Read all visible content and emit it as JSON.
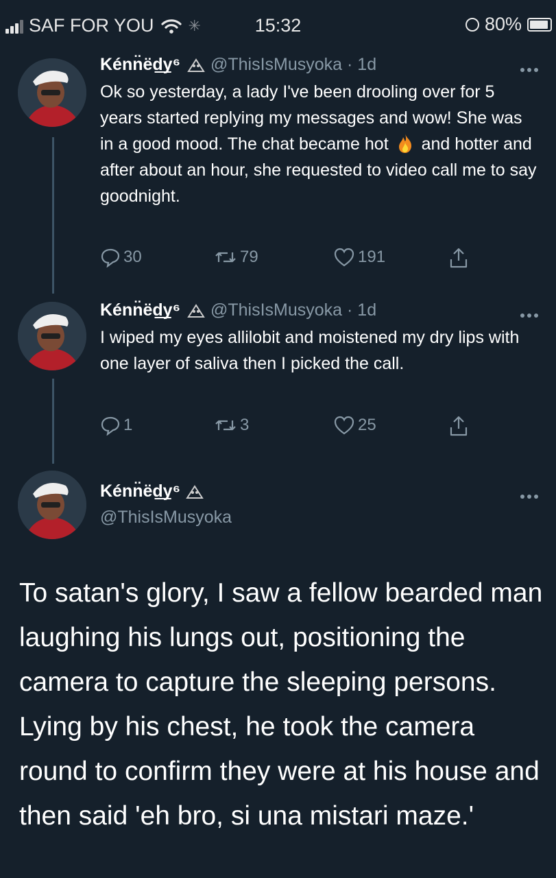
{
  "status_bar": {
    "carrier": "SAF FOR YOU",
    "time": "15:32",
    "battery": "80%",
    "battery_level": 0.8
  },
  "colors": {
    "background": "#15202b",
    "text_primary": "#ffffff",
    "text_secondary": "#8899a6",
    "thread_line": "#3d5466"
  },
  "tweets": [
    {
      "display_name": "Kénn̈ëd͟y⁶",
      "handle_time": "@ThisIsMusyoka · 1d",
      "text_before_emoji": "Ok so yesterday, a lady I've been drooling over for 5 years started replying my messages and wow! She was in a good mood. The chat became hot",
      "emoji": "fire-emoji",
      "text_after_emoji": "and hotter and after about an hour, she requested to video call me to say goodnight.",
      "replies": "30",
      "retweets": "79",
      "likes": "191"
    },
    {
      "display_name": "Kénn̈ëd͟y⁶",
      "handle_time": "@ThisIsMusyoka · 1d",
      "text": "I wiped my eyes allilobit and moistened my dry lips with one layer of saliva then I picked the call.",
      "replies": "1",
      "retweets": "3",
      "likes": "25"
    }
  ],
  "main_tweet": {
    "display_name": "Kénn̈ëd͟y⁶",
    "handle": "@ThisIsMusyoka",
    "text": "To satan's glory, I saw a fellow bearded man laughing his lungs out, positioning the camera to capture the sleeping persons. Lying by his chest, he took the camera round to confirm they were at his house and then said 'eh bro, si una mistari maze.'"
  }
}
